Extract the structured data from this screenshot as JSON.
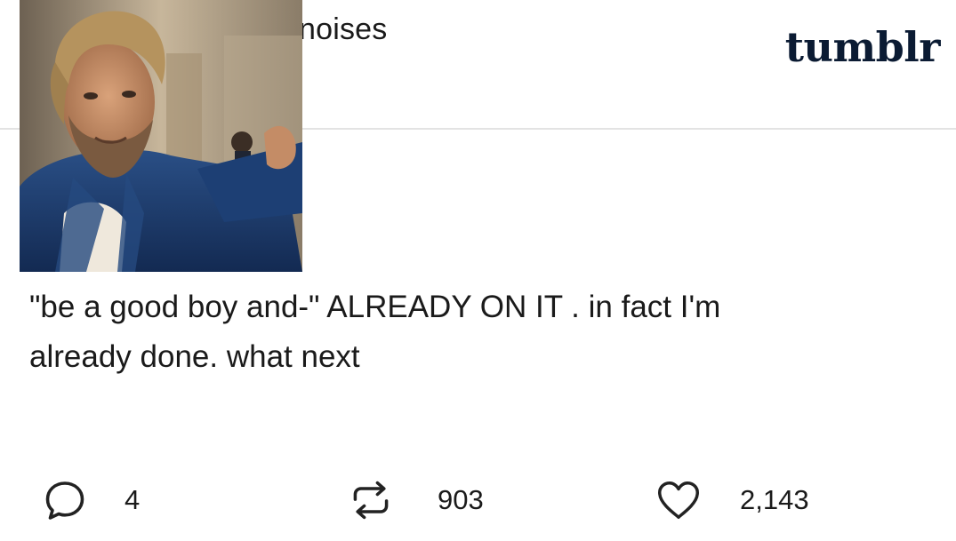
{
  "post": {
    "username": "noises",
    "brand": "tumblr",
    "text_line1": "\"be a good boy and-\" ALREADY ON IT . in fact I'm",
    "text_line2": "already done. what next"
  },
  "footer": {
    "comment_icon": "comment-bubble-icon",
    "comments": "4",
    "reblog_icon": "reblog-arrows-icon",
    "reblogs": "903",
    "like_icon": "heart-icon",
    "likes": "2,143"
  },
  "colors": {
    "text": "#1a1a1a",
    "brand": "#0b1b33",
    "divider": "#e3e3e3",
    "jacket": "#1f3a68"
  }
}
